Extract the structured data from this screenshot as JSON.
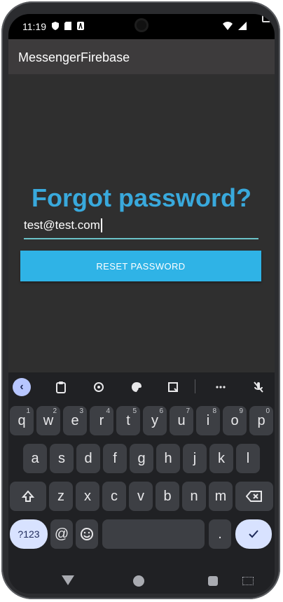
{
  "status_bar": {
    "time": "11:19"
  },
  "app_bar": {
    "title": "MessengerFirebase"
  },
  "screen": {
    "headline": "Forgot password?",
    "email_value": "test@test.com",
    "reset_label": "RESET PASSWORD"
  },
  "keyboard": {
    "row1": [
      {
        "key": "q",
        "hint": "1"
      },
      {
        "key": "w",
        "hint": "2"
      },
      {
        "key": "e",
        "hint": "3"
      },
      {
        "key": "r",
        "hint": "4"
      },
      {
        "key": "t",
        "hint": "5"
      },
      {
        "key": "y",
        "hint": "6"
      },
      {
        "key": "u",
        "hint": "7"
      },
      {
        "key": "i",
        "hint": "8"
      },
      {
        "key": "o",
        "hint": "9"
      },
      {
        "key": "p",
        "hint": "0"
      }
    ],
    "row2": [
      "a",
      "s",
      "d",
      "f",
      "g",
      "h",
      "j",
      "k",
      "l"
    ],
    "row3": [
      "z",
      "x",
      "c",
      "v",
      "b",
      "n",
      "m"
    ],
    "bottom": {
      "symbols": "?123",
      "at": "@",
      "period": "."
    }
  },
  "colors": {
    "accent": "#39a9dc",
    "button": "#2fb3e6"
  }
}
